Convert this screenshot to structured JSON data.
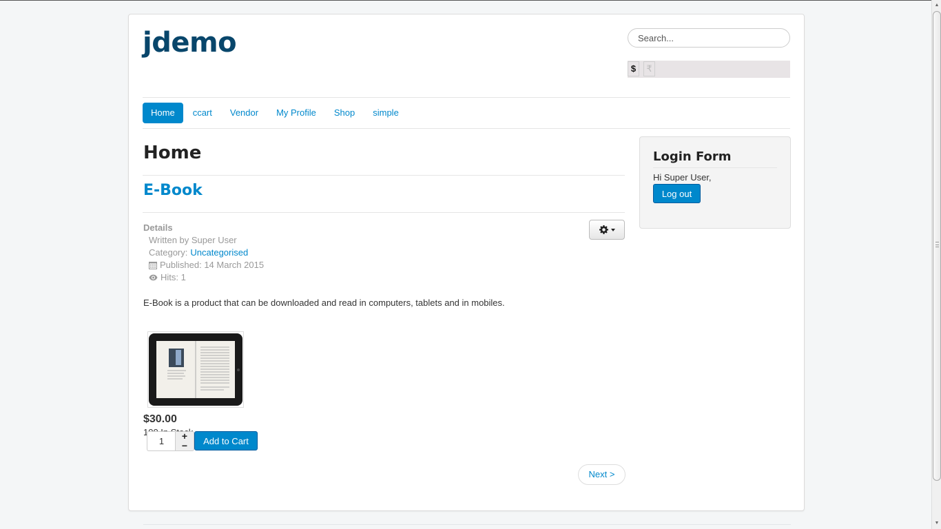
{
  "site": {
    "brand": "jdemo",
    "brand_color": "#08466b",
    "accent_color": "#0088cc"
  },
  "search": {
    "placeholder": "Search...",
    "value": ""
  },
  "currency": {
    "options": [
      {
        "symbol": "$",
        "selected": true
      },
      {
        "symbol": "₹",
        "selected": false
      }
    ]
  },
  "nav": {
    "items": [
      {
        "label": "Home",
        "active": true
      },
      {
        "label": "ccart",
        "active": false
      },
      {
        "label": "Vendor",
        "active": false
      },
      {
        "label": "My Profile",
        "active": false
      },
      {
        "label": "Shop",
        "active": false
      },
      {
        "label": "simple",
        "active": false
      }
    ]
  },
  "main": {
    "page_heading": "Home",
    "article_title": "E-Book",
    "details": {
      "heading": "Details",
      "written_by": "Written by Super User",
      "category_label": "Category: ",
      "category_value": "Uncategorised",
      "published": "Published: 14 March 2015",
      "hits": "Hits: 1"
    },
    "description": "E-Book is a product that can be downloaded and read in computers, tablets and in mobiles.",
    "product": {
      "image_alt": "E-Book tablet image",
      "price": "$30.00",
      "stock": "100 In Stock",
      "quantity": "1",
      "plus": "+",
      "minus": "−",
      "add_to_cart": "Add to Cart"
    },
    "pagination": {
      "next": "Next >"
    }
  },
  "sidebar": {
    "login_form": {
      "title": "Login Form",
      "greeting": "Hi Super User,",
      "logout": "Log out"
    }
  },
  "icons": {
    "gear": "gear-icon",
    "calendar": "calendar-icon",
    "eye": "eye-icon"
  }
}
